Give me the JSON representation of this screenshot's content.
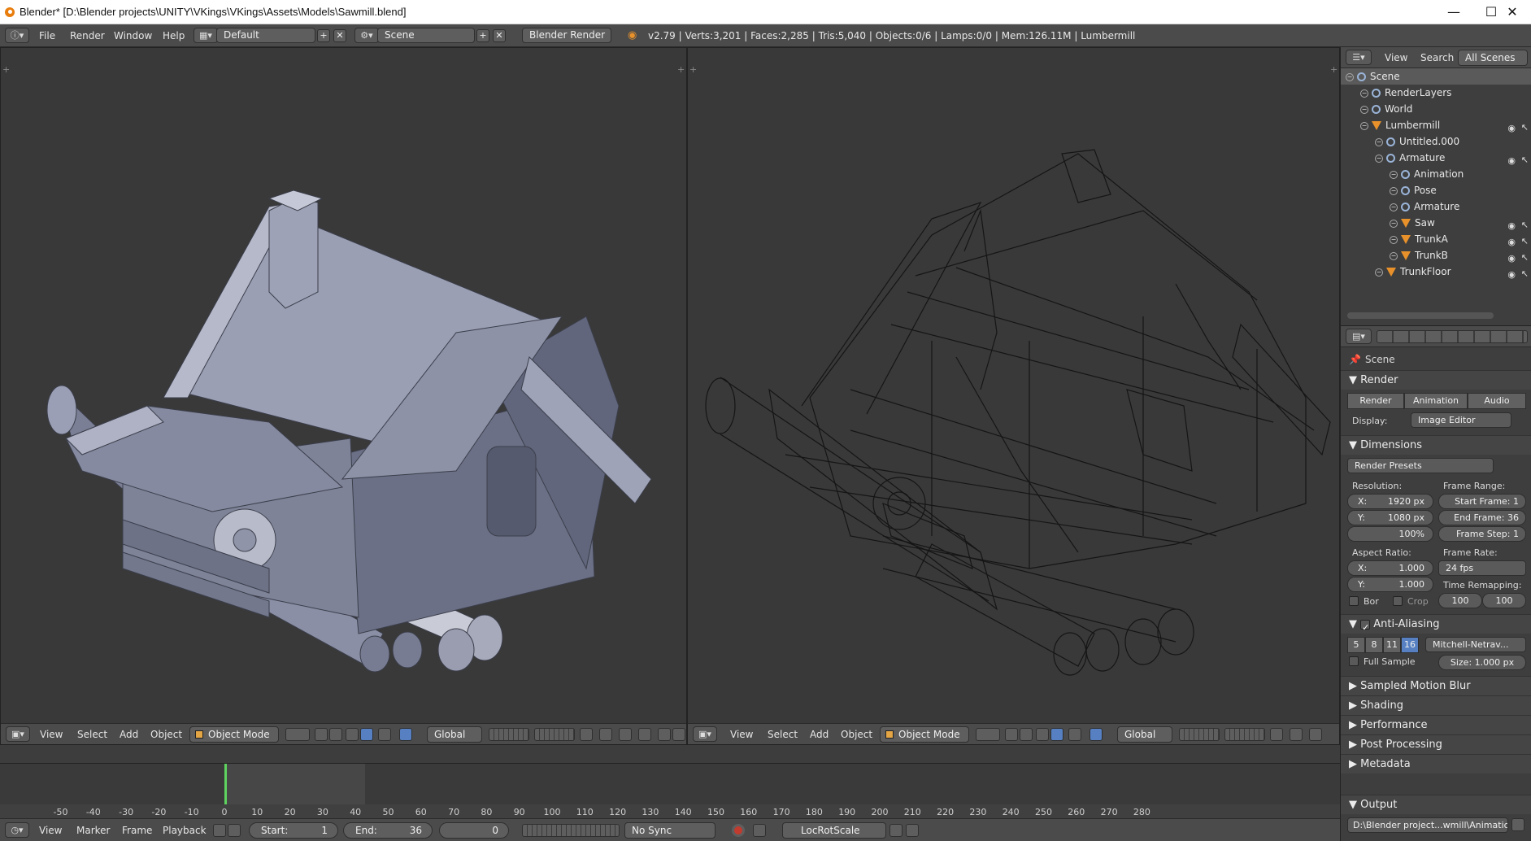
{
  "window": {
    "title": "Blender* [D:\\Blender projects\\UNITY\\VKings\\VKings\\Assets\\Models\\Sawmill.blend]",
    "minimize": "—",
    "maximize": "☐",
    "close": "✕"
  },
  "info_header": {
    "menus": [
      "File",
      "Render",
      "Window",
      "Help"
    ],
    "screen_layout": "Default",
    "scene": "Scene",
    "render_engine": "Blender Render",
    "stats": "v2.79 | Verts:3,201 | Faces:2,285 | Tris:5,040 | Objects:0/6 | Lamps:0/0 | Mem:126.11M | Lumbermill"
  },
  "viewport_left": {
    "menus": [
      "View",
      "Select",
      "Add",
      "Object"
    ],
    "mode": "Object Mode",
    "orientation": "Global",
    "shading": "solid"
  },
  "viewport_right": {
    "menus": [
      "View",
      "Select",
      "Add",
      "Object"
    ],
    "mode": "Object Mode",
    "orientation": "Global",
    "shading": "wireframe"
  },
  "timeline": {
    "ticks": [
      "-50",
      "-40",
      "-30",
      "-20",
      "-10",
      "0",
      "10",
      "20",
      "30",
      "40",
      "50",
      "60",
      "70",
      "80",
      "90",
      "100",
      "110",
      "120",
      "130",
      "140",
      "150",
      "160",
      "170",
      "180",
      "190",
      "200",
      "210",
      "220",
      "230",
      "240",
      "250",
      "260",
      "270",
      "280"
    ],
    "menus": [
      "View",
      "Marker",
      "Frame",
      "Playback"
    ],
    "start_label": "Start:",
    "start_value": "1",
    "end_label": "End:",
    "end_value": "36",
    "current_frame": "0",
    "sync": "No Sync",
    "keying_set": "LocRotScale"
  },
  "outliner": {
    "menus": [
      "View",
      "Search"
    ],
    "filter": "All Scenes",
    "items": [
      {
        "label": "Scene",
        "type": "scene",
        "depth": 0
      },
      {
        "label": "RenderLayers",
        "type": "renderlayers",
        "depth": 1
      },
      {
        "label": "World",
        "type": "world",
        "depth": 1
      },
      {
        "label": "Lumbermill",
        "type": "mesh",
        "depth": 1
      },
      {
        "label": "Untitled.000",
        "type": "mesh-data",
        "depth": 2
      },
      {
        "label": "Armature",
        "type": "armature",
        "depth": 2
      },
      {
        "label": "Animation",
        "type": "action",
        "depth": 3
      },
      {
        "label": "Pose",
        "type": "pose",
        "depth": 3
      },
      {
        "label": "Armature",
        "type": "armature-data",
        "depth": 3
      },
      {
        "label": "Saw",
        "type": "mesh",
        "depth": 3
      },
      {
        "label": "TrunkA",
        "type": "mesh",
        "depth": 3
      },
      {
        "label": "TrunkB",
        "type": "mesh",
        "depth": 3
      },
      {
        "label": "TrunkFloor",
        "type": "mesh",
        "depth": 2
      }
    ]
  },
  "properties": {
    "context": "Scene",
    "render_panel": {
      "title": "Render",
      "buttons": [
        "Render",
        "Animation",
        "Audio"
      ],
      "display_label": "Display:",
      "display_value": "Image Editor"
    },
    "dimensions_panel": {
      "title": "Dimensions",
      "presets": "Render Presets",
      "resolution_label": "Resolution:",
      "res_x": "1920 px",
      "res_y": "1080 px",
      "res_pct": "100%",
      "frame_range_label": "Frame Range:",
      "start_frame": "Start Frame: 1",
      "end_frame": "End Frame: 36",
      "frame_step": "Frame Step: 1",
      "aspect_label": "Aspect Ratio:",
      "aspect_x": "1.000",
      "aspect_y": "1.000",
      "frame_rate_label": "Frame Rate:",
      "frame_rate": "24 fps",
      "time_remap_label": "Time Remapping:",
      "remap_old": "100",
      "remap_new": "100",
      "border": "Bor",
      "crop": "Crop"
    },
    "aa_panel": {
      "title": "Anti-Aliasing",
      "samples": [
        "5",
        "8",
        "11",
        "16"
      ],
      "active_sample": "16",
      "filter": "Mitchell-Netrav...",
      "full_sample": "Full Sample",
      "size": "Size: 1.000 px"
    },
    "collapsed_panels": [
      "Sampled Motion Blur",
      "Shading",
      "Performance",
      "Post Processing",
      "Metadata"
    ],
    "output_panel": {
      "title": "Output",
      "path": "D:\\Blender project...wmill\\Animation\\"
    }
  }
}
